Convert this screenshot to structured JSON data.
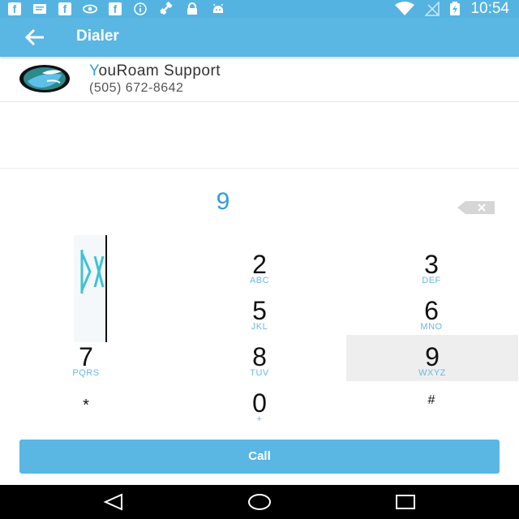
{
  "status_bar": {
    "time": "10:54",
    "left_icons": [
      "facebook-icon",
      "message-icon",
      "facebook-icon",
      "eye-icon",
      "facebook-icon",
      "info-icon",
      "satellite-icon",
      "lock-icon",
      "android-icon"
    ],
    "right_icons": [
      "wifi-icon",
      "no-signal-icon",
      "battery-charging-icon"
    ]
  },
  "app_bar": {
    "title": "Dialer",
    "back_icon": "back-arrow-icon"
  },
  "contact": {
    "name_first_letter": "Y",
    "name_rest": "ouRoam Support",
    "number": "(505) 672-8642"
  },
  "dialed_number": "9",
  "keypad": {
    "keys": [
      {
        "digit": "2",
        "letters": "ABC"
      },
      {
        "digit": "3",
        "letters": "DEF"
      },
      {
        "digit": "5",
        "letters": "JKL"
      },
      {
        "digit": "6",
        "letters": "MNO"
      },
      {
        "digit": "7",
        "letters": "PQRS"
      },
      {
        "digit": "8",
        "letters": "TUV"
      },
      {
        "digit": "9",
        "letters": "WXYZ"
      },
      {
        "digit": "*",
        "letters": ""
      },
      {
        "digit": "0",
        "letters": "+"
      },
      {
        "digit": "#",
        "letters": ""
      }
    ]
  },
  "call_button": {
    "label": "Call"
  },
  "colors": {
    "accent": "#5ab6e3",
    "status_bar": "#55b3e1",
    "link_blue": "#2e9fd8",
    "letters": "#6ab8e0"
  }
}
